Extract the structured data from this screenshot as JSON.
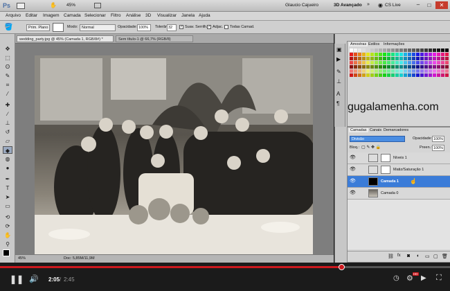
{
  "titlebar": {
    "app_logo": "Ps",
    "zoom": "45%",
    "user": "Glaucio Cajueiro",
    "workspace": "3D Avançado",
    "cs_live": "CS Live"
  },
  "menu": [
    "Arquivo",
    "Editar",
    "Imagem",
    "Camada",
    "Selecionar",
    "Filtro",
    "Análise",
    "3D",
    "Visualizar",
    "Janela",
    "Ajuda"
  ],
  "options": {
    "preset": "Prim. Plano",
    "mode_label": "Modo:",
    "mode_value": "Normal",
    "opacity_label": "Opacidade:",
    "opacity_value": "100%",
    "tolerance_label": "Tolerância:",
    "tolerance_value": "32",
    "antialias_label": "Suav. Serrilh.",
    "contiguous_label": "Adjac.",
    "all_layers_label": "Todas Camad."
  },
  "doc_tabs": [
    {
      "label": "wedding_party.jpg @ 45% (Camada 1, RGB/8#) *",
      "active": true
    },
    {
      "label": "Sem título-1 @ 66,7% (RGB/8)",
      "active": false
    }
  ],
  "status": {
    "zoom": "45%",
    "doc": "Doc: 5,85M/11,9M"
  },
  "swatches_panel": {
    "tabs": [
      "Amostras",
      "Estilos",
      "Informações"
    ]
  },
  "watermark": "gugalamenha.com",
  "layers_panel": {
    "tabs": [
      "Camadas",
      "Canais",
      "Demarcadores"
    ],
    "blend_mode": "Divisão",
    "opacity_label": "Opacidade:",
    "opacity_value": "100%",
    "lock_label": "Bloq.:",
    "fill_label": "Preen.:",
    "fill_value": "100%",
    "layers": [
      {
        "name": "Níveis 1",
        "selected": false
      },
      {
        "name": "Matiz/Saturação 1",
        "selected": false
      },
      {
        "name": "Camada 1",
        "selected": true
      },
      {
        "name": "Camada 0",
        "selected": false
      }
    ]
  },
  "player": {
    "current_time": "2:05",
    "duration": "2:45",
    "progress": 0.758,
    "hd_badge": "HD"
  },
  "colors": {
    "accent": "#cc181e",
    "selected_layer": "#3b7cd8"
  }
}
